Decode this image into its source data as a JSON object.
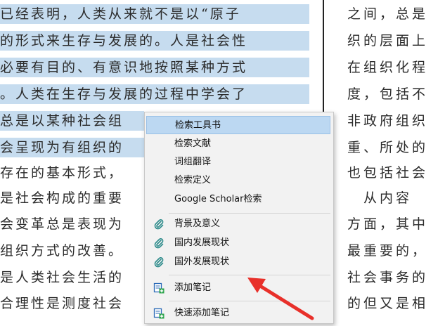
{
  "document": {
    "left_lines": [
      "已经表明，人类从来就不是以“原子",
      "的形式来生存与发展的。人是社会性",
      "必要有目的、有意识地按照某种方式",
      "。人类在生存与发展的过程中学会了",
      "总是以某种社会组",
      "会呈现为有组织的",
      "存在的基本形式，",
      "是社会构成的重要",
      "会变革总是表现为",
      "组织方式的改善。",
      "是人类社会生活的",
      "合理性是测度社会"
    ],
    "right_lines": [
      "之间，总是",
      "织的层面上",
      "在组织化程",
      "度，包括不",
      "非政府组织",
      "重、所处的",
      "也包括社会",
      "　从内容",
      "方面，其中",
      "最重要的，",
      "社会事务的",
      "的但又是相"
    ]
  },
  "context_menu": {
    "items": [
      {
        "label": "检索工具书",
        "icon": "none",
        "active": true
      },
      {
        "label": "检索文献",
        "icon": "none"
      },
      {
        "label": "词组翻译",
        "icon": "none"
      },
      {
        "label": "检索定义",
        "icon": "none"
      },
      {
        "label": "Google Scholar检索",
        "icon": "none"
      },
      {
        "label": "背景及意义",
        "icon": "paperclip-icon"
      },
      {
        "label": "国内发展现状",
        "icon": "paperclip-icon"
      },
      {
        "label": "国外发展现状",
        "icon": "paperclip-icon"
      },
      {
        "label": "添加笔记",
        "icon": "add-note-icon"
      },
      {
        "label": "快速添加笔记",
        "icon": "add-note-icon"
      }
    ]
  },
  "colors": {
    "selection": "#c6dcef",
    "menu_bg": "#f2f2f2",
    "menu_active": "#bcd8f2",
    "arrow": "#e8302a",
    "clip_icon": "#2b8a8a",
    "note_icon": "#2a6ab7"
  }
}
